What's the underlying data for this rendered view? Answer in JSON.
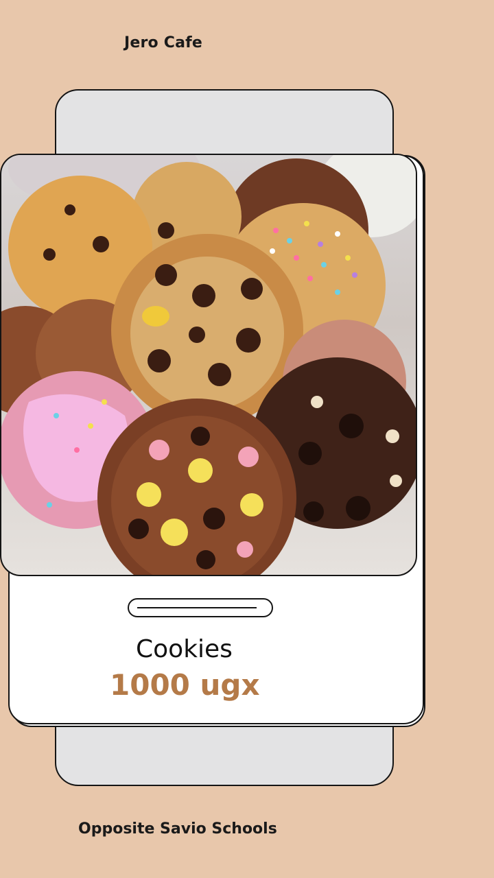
{
  "header": {
    "brand": "Jero Cafe"
  },
  "product": {
    "image": "cookies-photo",
    "name": "Cookies",
    "price": "1000 ugx"
  },
  "footer": {
    "address": "Opposite Savio Schools"
  },
  "colors": {
    "background": "#e8c7ab",
    "price": "#b47a48",
    "card": "#ffffff",
    "back_card": "#e3e3e4"
  }
}
